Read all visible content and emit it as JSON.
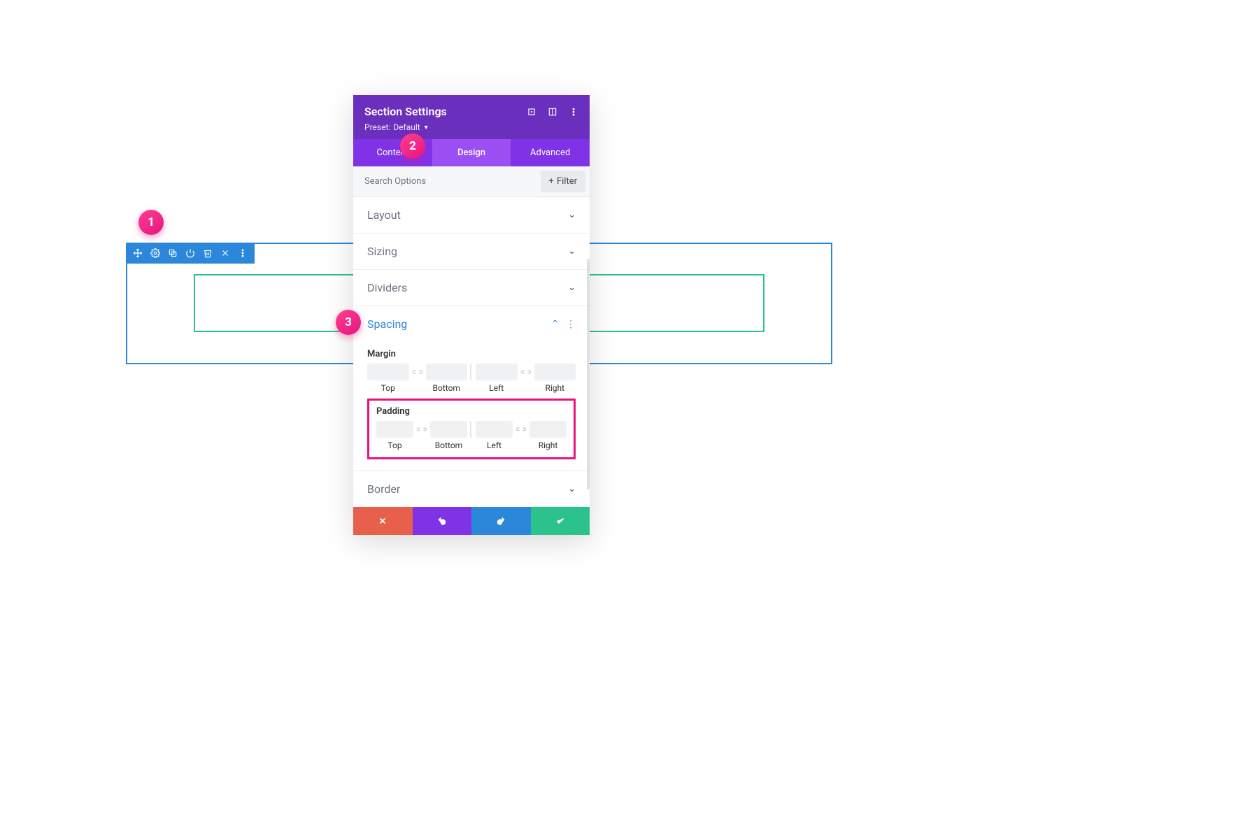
{
  "section_toolbar": {
    "icons": [
      "move-icon",
      "gear-icon",
      "duplicate-icon",
      "power-icon",
      "trash-icon",
      "close-icon",
      "more-icon"
    ]
  },
  "panel": {
    "title": "Section Settings",
    "preset_label": "Preset:",
    "preset_value": "Default",
    "header_icons": [
      "expand-icon",
      "snap-icon",
      "more-icon"
    ]
  },
  "tabs": {
    "content": "Content",
    "design": "Design",
    "advanced": "Advanced",
    "active": "design"
  },
  "search": {
    "placeholder": "Search Options",
    "filter_label": "Filter"
  },
  "accordion": {
    "layout": "Layout",
    "sizing": "Sizing",
    "dividers": "Dividers",
    "spacing": "Spacing",
    "border": "Border"
  },
  "spacing": {
    "margin_label": "Margin",
    "padding_label": "Padding",
    "sides": {
      "top": "Top",
      "bottom": "Bottom",
      "left": "Left",
      "right": "Right"
    }
  },
  "footer": {
    "cancel": "cancel",
    "undo": "undo",
    "redo": "redo",
    "ok": "ok"
  },
  "badges": {
    "1": "1",
    "2": "2",
    "3": "3"
  }
}
